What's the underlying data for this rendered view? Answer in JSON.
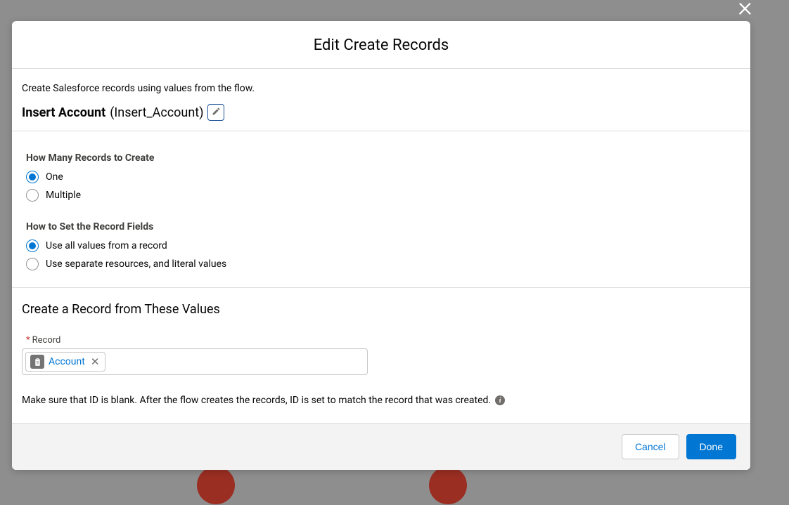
{
  "modal": {
    "title": "Edit Create Records",
    "intro": "Create Salesforce records using values from the flow.",
    "elementLabel": "Insert Account",
    "elementApi": "(Insert_Account)"
  },
  "howMany": {
    "label": "How Many Records to Create",
    "opt1": "One",
    "opt2": "Multiple"
  },
  "howSet": {
    "label": "How to Set the Record Fields",
    "opt1": "Use all values from a record",
    "opt2": "Use separate resources, and literal values"
  },
  "values": {
    "heading": "Create a Record from These Values",
    "requiredMark": "*",
    "recordLabel": "Record",
    "pill": "Account",
    "hint": "Make sure that ID is blank. After the flow creates the records, ID is set to match the record that was created."
  },
  "footer": {
    "cancel": "Cancel",
    "done": "Done"
  }
}
